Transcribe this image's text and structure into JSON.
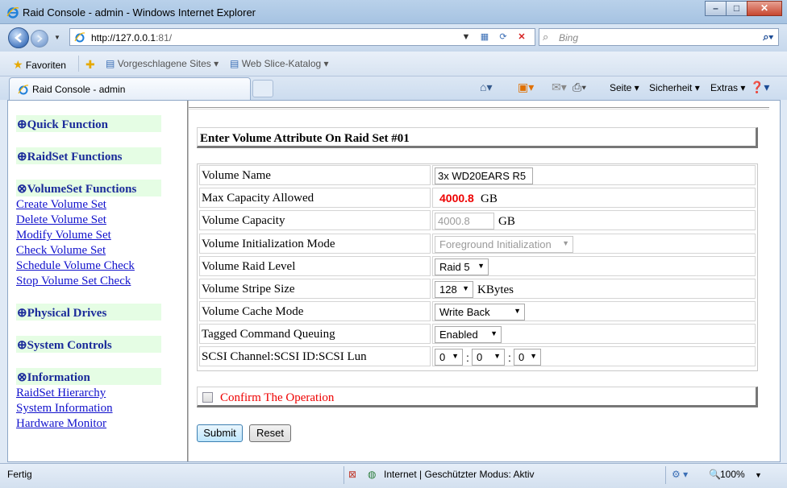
{
  "window": {
    "title": "Raid Console - admin - Windows Internet Explorer",
    "min": "–",
    "max": "□",
    "close": "✕"
  },
  "nav": {
    "url_host": "http://127.0.0.1",
    "url_rest": ":81/",
    "search_placeholder": "Bing"
  },
  "favbar": {
    "favorites": "Favoriten",
    "suggested": "Vorgeschlagene Sites ▾",
    "webslice": "Web Slice-Katalog ▾"
  },
  "tab": {
    "label": "Raid Console - admin"
  },
  "commands": {
    "page": "Seite ▾",
    "security": "Sicherheit ▾",
    "extras": "Extras ▾"
  },
  "menu": {
    "quick_function": "⊕Quick Function",
    "raidset_functions": "⊕RaidSet Functions",
    "volumeset_functions": "⊗VolumeSet Functions",
    "volumeset_links": [
      "Create Volume Set",
      "Delete Volume Set",
      "Modify Volume Set",
      "Check Volume Set",
      "Schedule Volume Check",
      "Stop Volume Set Check"
    ],
    "physical_drives": "⊕Physical Drives",
    "system_controls": "⊕System Controls",
    "information": "⊗Information",
    "information_links": [
      "RaidSet Hierarchy",
      "System Information",
      "Hardware Monitor"
    ]
  },
  "form": {
    "heading": "Enter Volume Attribute On Raid Set #01",
    "rows": {
      "volume_name": {
        "label": "Volume Name",
        "value": "3x WD20EARS R5"
      },
      "max_capacity": {
        "label": "Max Capacity Allowed",
        "value": "4000.8",
        "unit": "GB"
      },
      "volume_capacity": {
        "label": "Volume Capacity",
        "value": "4000.8",
        "unit": "GB"
      },
      "init_mode": {
        "label": "Volume Initialization Mode",
        "value": "Foreground Initialization"
      },
      "raid_level": {
        "label": "Volume Raid Level",
        "value": "Raid 5"
      },
      "stripe_size": {
        "label": "Volume Stripe Size",
        "value": "128",
        "unit": "KBytes"
      },
      "cache_mode": {
        "label": "Volume Cache Mode",
        "value": "Write Back"
      },
      "tcq": {
        "label": "Tagged Command Queuing",
        "value": "Enabled"
      },
      "scsi": {
        "label": "SCSI Channel:SCSI ID:SCSI Lun",
        "channel": "0",
        "id": "0",
        "lun": "0",
        "sep": ":"
      }
    },
    "confirm": "Confirm The Operation",
    "submit": "Submit",
    "reset": "Reset"
  },
  "status": {
    "left": "Fertig",
    "zone": "Internet | Geschützter Modus: Aktiv",
    "zoom": "100%"
  },
  "colors": {
    "menu_bg": "#e5fde4",
    "menu_head_text": "#1b2b9a",
    "link": "#1212cc",
    "alert_red": "#e00000"
  }
}
